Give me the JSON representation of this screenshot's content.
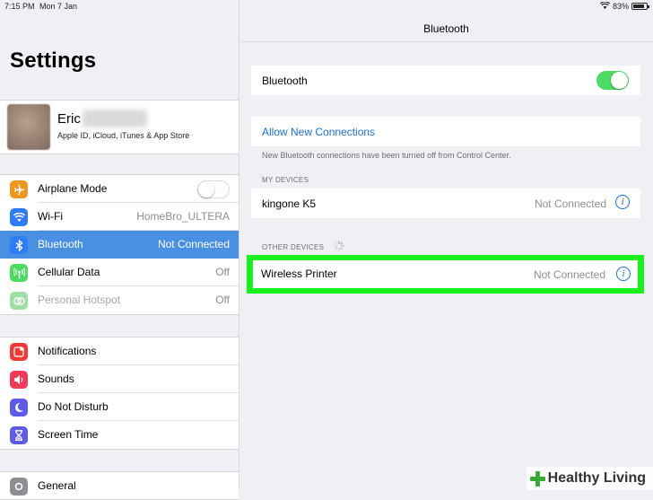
{
  "status_bar": {
    "time": "7:15 PM",
    "date": "Mon 7 Jan",
    "battery": "83%"
  },
  "left": {
    "title": "Settings",
    "profile": {
      "name": "Eric",
      "subtitle": "Apple ID, iCloud, iTunes & App Store"
    },
    "connectivity": [
      {
        "label": "Airplane Mode",
        "icon": "airplane-icon",
        "color": "#f0961e",
        "toggle": false
      },
      {
        "label": "Wi-Fi",
        "value": "HomeBro_ULTERA",
        "icon": "wifi-icon",
        "color": "#2f7cf6"
      },
      {
        "label": "Bluetooth",
        "value": "Not Connected",
        "icon": "bluetooth-icon",
        "color": "#2f7cf6",
        "selected": true
      },
      {
        "label": "Cellular Data",
        "value": "Off",
        "icon": "antenna-icon",
        "color": "#4cd964"
      },
      {
        "label": "Personal Hotspot",
        "value": "Off",
        "icon": "hotspot-icon",
        "color": "#9fdfa4",
        "dim": true
      }
    ],
    "notifications": [
      {
        "label": "Notifications",
        "icon": "notifications-icon",
        "color": "#f03a3a"
      },
      {
        "label": "Sounds",
        "icon": "speaker-icon",
        "color": "#f03a5a"
      },
      {
        "label": "Do Not Disturb",
        "icon": "moon-icon",
        "color": "#5e5ce6"
      },
      {
        "label": "Screen Time",
        "icon": "hourglass-icon",
        "color": "#5e5ce6"
      }
    ],
    "general": {
      "label": "General",
      "icon": "gear-icon",
      "color": "#8e8e93"
    }
  },
  "right": {
    "nav_title": "Bluetooth",
    "bluetooth_label": "Bluetooth",
    "bluetooth_on": true,
    "allow_label": "Allow New Connections",
    "note": "New Bluetooth connections have been turned off from Control Center.",
    "my_devices_header": "MY DEVICES",
    "my_devices": [
      {
        "name": "kingone K5",
        "status": "Not Connected"
      }
    ],
    "other_devices_header": "OTHER DEVICES",
    "other_devices": [
      {
        "name": "Wireless Printer",
        "status": "Not Connected"
      }
    ]
  },
  "watermark": "Healthy Living"
}
